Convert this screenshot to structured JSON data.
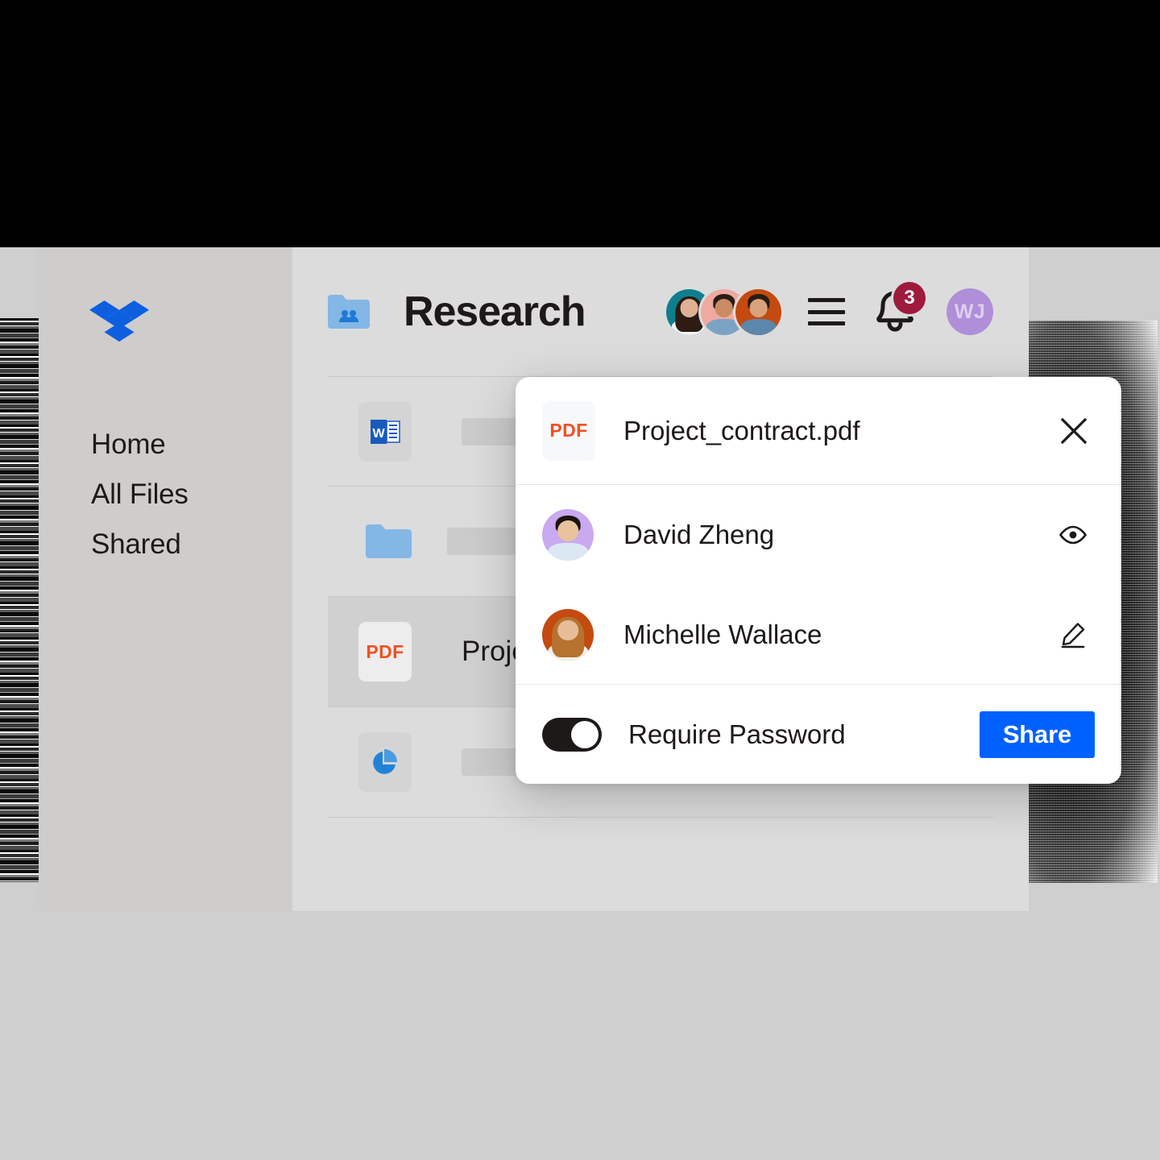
{
  "sidebar": {
    "logo_icon": "dropbox-logo",
    "items": [
      {
        "label": "Home"
      },
      {
        "label": "All Files"
      },
      {
        "label": "Shared"
      }
    ]
  },
  "header": {
    "folder_icon": "shared-folder-icon",
    "title": "Research",
    "avatars": [
      {
        "name": "team-member-1",
        "bg": "#0f7e8c",
        "skin": "#e0b095",
        "hair": "#2d1b14",
        "shirt": "#f2f2f2"
      },
      {
        "name": "team-member-2",
        "bg": "#efa9a1",
        "skin": "#c98b63",
        "hair": "#2b1d16",
        "shirt": "#7ba4c4"
      },
      {
        "name": "team-member-3",
        "bg": "#c44a10",
        "skin": "#d8a27c",
        "hair": "#2a1c14",
        "shirt": "#5d87ab"
      }
    ],
    "menu_icon": "hamburger-menu-icon",
    "notifications": {
      "icon": "bell-icon",
      "count": "3",
      "badge_color": "#9e1b3c"
    },
    "user": {
      "initials": "WJ",
      "color": "#af8fd8"
    }
  },
  "file_list": {
    "rows": [
      {
        "icon": "word-document-icon",
        "name": "",
        "selected": false
      },
      {
        "icon": "folder-icon",
        "name": "",
        "selected": false
      },
      {
        "icon": "pdf-file-icon",
        "badge": "PDF",
        "name": "Project_",
        "selected": true
      },
      {
        "icon": "presentation-chart-icon",
        "name": "",
        "selected": false
      }
    ]
  },
  "modal": {
    "file_icon": "pdf-file-icon",
    "file_badge": "PDF",
    "file_name": "Project_contract.pdf",
    "close_icon": "close-icon",
    "people": [
      {
        "name": "David Zheng",
        "permission_icon": "eye-icon",
        "avatar_bg": "#c9a9f0",
        "skin": "#e8c39e",
        "hair": "#1c1410",
        "shirt": "#dbe8f4"
      },
      {
        "name": "Michelle Wallace",
        "permission_icon": "pencil-icon",
        "avatar_bg": "#c44a10",
        "skin": "#e6bd97",
        "hair": "#b5732f",
        "shirt": "#f4f1ec"
      }
    ],
    "footer": {
      "toggle_label": "Require Password",
      "toggle_on": true,
      "share_label": "Share",
      "share_color": "#0061ff"
    }
  }
}
